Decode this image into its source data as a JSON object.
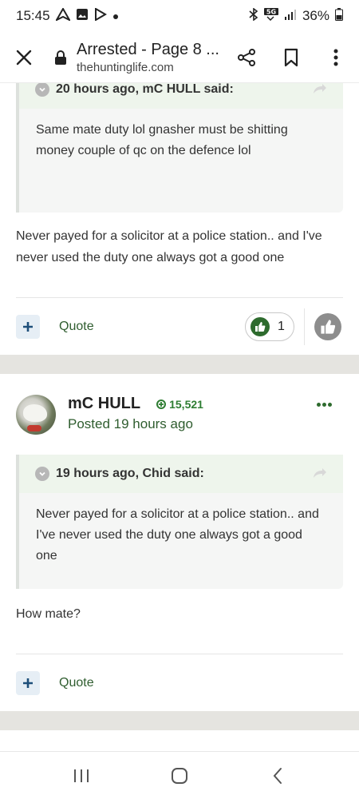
{
  "status_bar": {
    "time": "15:45",
    "left_icons": [
      "navigation-arrow-icon",
      "image-icon",
      "play-store-icon",
      "dot-icon"
    ],
    "right_icons": [
      "bluetooth-icon",
      "5g-icon",
      "signal-icon"
    ],
    "network_label": "5G",
    "battery": "36%"
  },
  "browser": {
    "title": "Arrested - Page 8 ...",
    "url": "thehuntinglife.com"
  },
  "posts": [
    {
      "quote": {
        "header": "20 hours ago, mC HULL said:",
        "text": "Same mate duty lol gnasher must be shitting money couple  of qc on the defence lol"
      },
      "body": "Never payed for a solicitor at a police station.. and I've never used the duty one always got a good one",
      "quote_label": "Quote",
      "like_count": "1"
    },
    {
      "author": "mC HULL",
      "reputation": "15,521",
      "posted": "Posted 19 hours ago",
      "quote": {
        "header": "19 hours ago, Chid said:",
        "text": "Never payed for a solicitor at a police station.. and I've never used the duty one always got a good one"
      },
      "body": "How mate?",
      "quote_label": "Quote"
    }
  ],
  "colors": {
    "accent_green": "#2e6b2e",
    "quote_header_bg": "#eef5ec",
    "band_gray": "#e5e4e0"
  }
}
